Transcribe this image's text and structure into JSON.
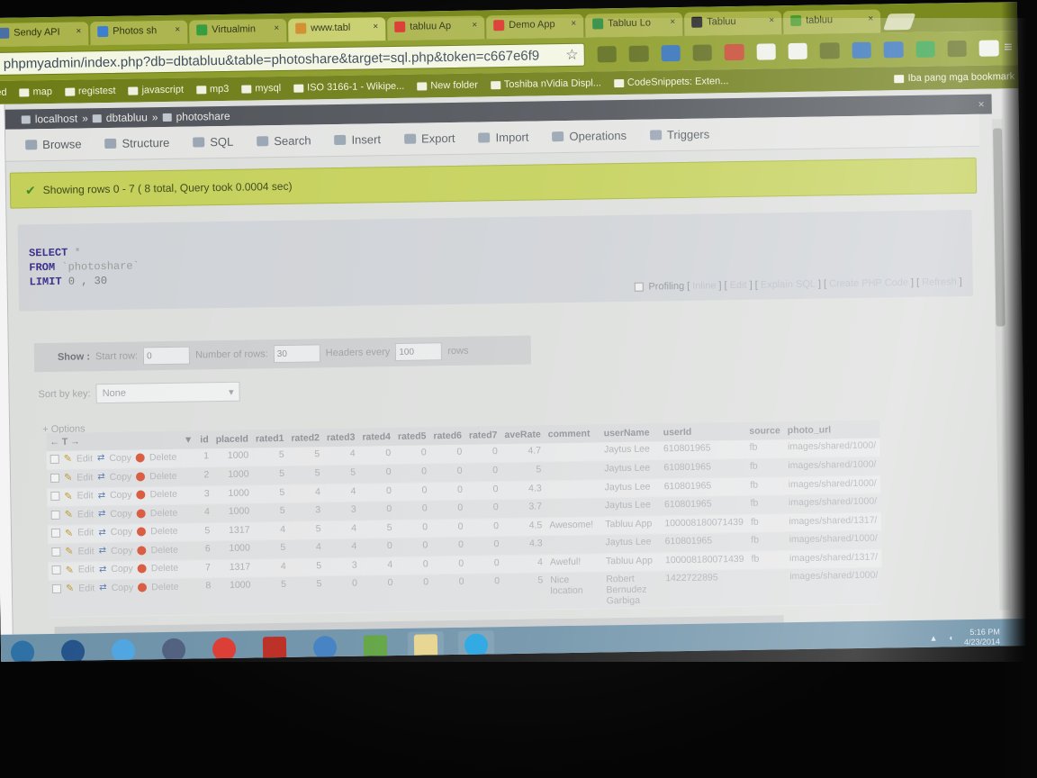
{
  "browser": {
    "tabs": [
      {
        "label": "Sendy API",
        "favicon": "gear-icon",
        "color": "#4a6fa5"
      },
      {
        "label": "Photos sh",
        "favicon": "puzzle-icon",
        "color": "#3b7ccf"
      },
      {
        "label": "Virtualmin",
        "favicon": "check-icon",
        "color": "#2f9a3a"
      },
      {
        "label": "www.tabl",
        "favicon": "page-icon",
        "color": "#d08b2a",
        "active": true
      },
      {
        "label": "tabluu Ap",
        "favicon": "ac-icon",
        "color": "#d9342b"
      },
      {
        "label": "Demo App",
        "favicon": "ac-icon",
        "color": "#d9342b"
      },
      {
        "label": "Tabluu Lo",
        "favicon": "sheet-icon",
        "color": "#2a8a3a"
      },
      {
        "label": "Tabluu",
        "favicon": "github-icon",
        "color": "#222222"
      },
      {
        "label": "tabluu",
        "favicon": "leaf-icon",
        "color": "#4a9a2a"
      }
    ],
    "tab_close": "×",
    "url": "phpmyadmin/index.php?db=dbtabluu&table=photoshare&target=sql.php&token=c667e6f9",
    "star": "☆",
    "menu": "≡",
    "bookmarks": [
      "ed",
      "map",
      "registest",
      "javascript",
      "mp3",
      "mysql",
      "ISO 3166-1 - Wikipe...",
      "New folder",
      "Toshiba nVidia Displ...",
      "CodeSnippets: Exten..."
    ],
    "other_bookmarks": "Iba pang mga bookmark"
  },
  "pma": {
    "breadcrumb": [
      "localhost",
      "dbtabluu",
      "photoshare"
    ],
    "close": "×",
    "tabs": [
      "Browse",
      "Structure",
      "SQL",
      "Search",
      "Insert",
      "Export",
      "Import",
      "Operations",
      "Triggers"
    ],
    "success": "Showing rows 0 - 7 ( 8 total, Query took 0.0004 sec)",
    "sql": {
      "line1_kw": "SELECT",
      "line1_rest": "*",
      "line2_kw": "FROM",
      "line2_rest": "`photoshare`",
      "line3_kw": "LIMIT",
      "line3_rest": "0 , 30"
    },
    "sql_links": {
      "profiling": "Profiling",
      "items": [
        "Inline",
        "Edit",
        "Explain SQL",
        "Create PHP Code",
        "Refresh"
      ]
    },
    "show": {
      "label": "Show :",
      "start_row_label": "Start row:",
      "start_row": "0",
      "num_rows_label": "Number of rows:",
      "num_rows": "30",
      "headers_every_label": "Headers every",
      "headers_every": "100",
      "rows_label": "rows"
    },
    "sort": {
      "label": "Sort by key:",
      "value": "None",
      "arrow": "▾"
    },
    "options_label": "+ Options",
    "columns": [
      "id",
      "placeId",
      "rated1",
      "rated2",
      "rated3",
      "rated4",
      "rated5",
      "rated6",
      "rated7",
      "aveRate",
      "comment",
      "userName",
      "userId",
      "source",
      "photo_url"
    ],
    "row_actions": {
      "edit": "Edit",
      "copy": "Copy",
      "delete": "Delete"
    },
    "rows": [
      [
        "1",
        "1000",
        "5",
        "5",
        "4",
        "0",
        "0",
        "0",
        "0",
        "4.7",
        "",
        "Jaytus Lee",
        "610801965",
        "fb",
        "images/shared/1000/"
      ],
      [
        "2",
        "1000",
        "5",
        "5",
        "5",
        "0",
        "0",
        "0",
        "0",
        "5",
        "",
        "Jaytus Lee",
        "610801965",
        "fb",
        "images/shared/1000/"
      ],
      [
        "3",
        "1000",
        "5",
        "4",
        "4",
        "0",
        "0",
        "0",
        "0",
        "4.3",
        "",
        "Jaytus Lee",
        "610801965",
        "fb",
        "images/shared/1000/"
      ],
      [
        "4",
        "1000",
        "5",
        "3",
        "3",
        "0",
        "0",
        "0",
        "0",
        "3.7",
        "",
        "Jaytus Lee",
        "610801965",
        "fb",
        "images/shared/1000/"
      ],
      [
        "5",
        "1317",
        "4",
        "5",
        "4",
        "5",
        "0",
        "0",
        "0",
        "4.5",
        "Awesome!",
        "Tabluu App",
        "100008180071439",
        "fb",
        "images/shared/1317/"
      ],
      [
        "6",
        "1000",
        "5",
        "4",
        "4",
        "0",
        "0",
        "0",
        "0",
        "4.3",
        "",
        "Jaytus Lee",
        "610801965",
        "fb",
        "images/shared/1000/"
      ],
      [
        "7",
        "1317",
        "4",
        "5",
        "3",
        "4",
        "0",
        "0",
        "0",
        "4",
        "Aweful!",
        "Tabluu App",
        "100008180071439",
        "fb",
        "images/shared/1317/"
      ],
      [
        "8",
        "1000",
        "5",
        "5",
        "0",
        "0",
        "0",
        "0",
        "0",
        "5",
        "Nice location",
        "Robert Bernudez Garbiga",
        "1422722895",
        "",
        "images/shared/1000/"
      ]
    ]
  },
  "taskbar": {
    "apps": [
      {
        "name": "start-orb-icon",
        "color": "#2a6ea3"
      },
      {
        "name": "norton-icon",
        "color": "#1f4f87"
      },
      {
        "name": "ie-icon",
        "color": "#4aa3e0"
      },
      {
        "name": "media-player-icon",
        "color": "#4a5a7a"
      },
      {
        "name": "chrome-icon",
        "color": "#d9342b"
      },
      {
        "name": "filezilla-icon",
        "color": "#b8241a"
      },
      {
        "name": "network-icon",
        "color": "#3a7bbf"
      },
      {
        "name": "chart-icon",
        "color": "#5aa03a"
      },
      {
        "name": "folder-icon",
        "color": "#e6d28a"
      },
      {
        "name": "skype-icon",
        "color": "#1da1e0"
      }
    ],
    "clock_time": "5:16 PM",
    "clock_date": "4/23/2014"
  }
}
